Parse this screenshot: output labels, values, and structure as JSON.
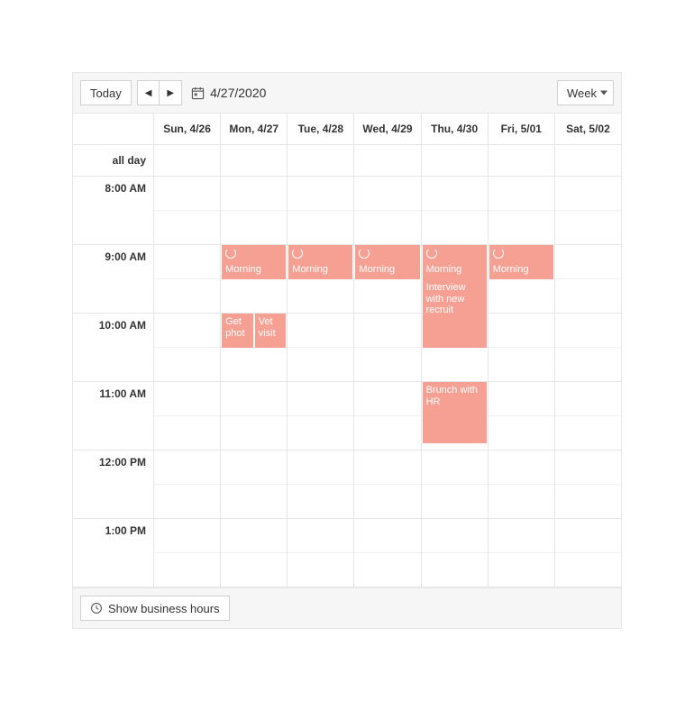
{
  "toolbar": {
    "today_label": "Today",
    "date_display": "4/27/2020",
    "view_label": "Week"
  },
  "header": {
    "days": [
      "Sun, 4/26",
      "Mon, 4/27",
      "Tue, 4/28",
      "Wed, 4/29",
      "Thu, 4/30",
      "Fri, 5/01",
      "Sat, 5/02"
    ],
    "allday_label": "all day"
  },
  "times": [
    "8:00 AM",
    "9:00 AM",
    "10:00 AM",
    "11:00 AM",
    "12:00 PM",
    "1:00 PM"
  ],
  "events": {
    "morning_mon": "Morning",
    "morning_tue": "Morning",
    "morning_wed": "Morning",
    "morning_thu": "Morning",
    "morning_fri": "Morning",
    "get_photo": "Get phot",
    "vet_visit": "Vet visit",
    "interview": "Interview with new recruit",
    "brunch": "Brunch with HR"
  },
  "footer": {
    "business_hours_label": "Show business hours"
  },
  "colors": {
    "event_bg": "#f69f93"
  }
}
